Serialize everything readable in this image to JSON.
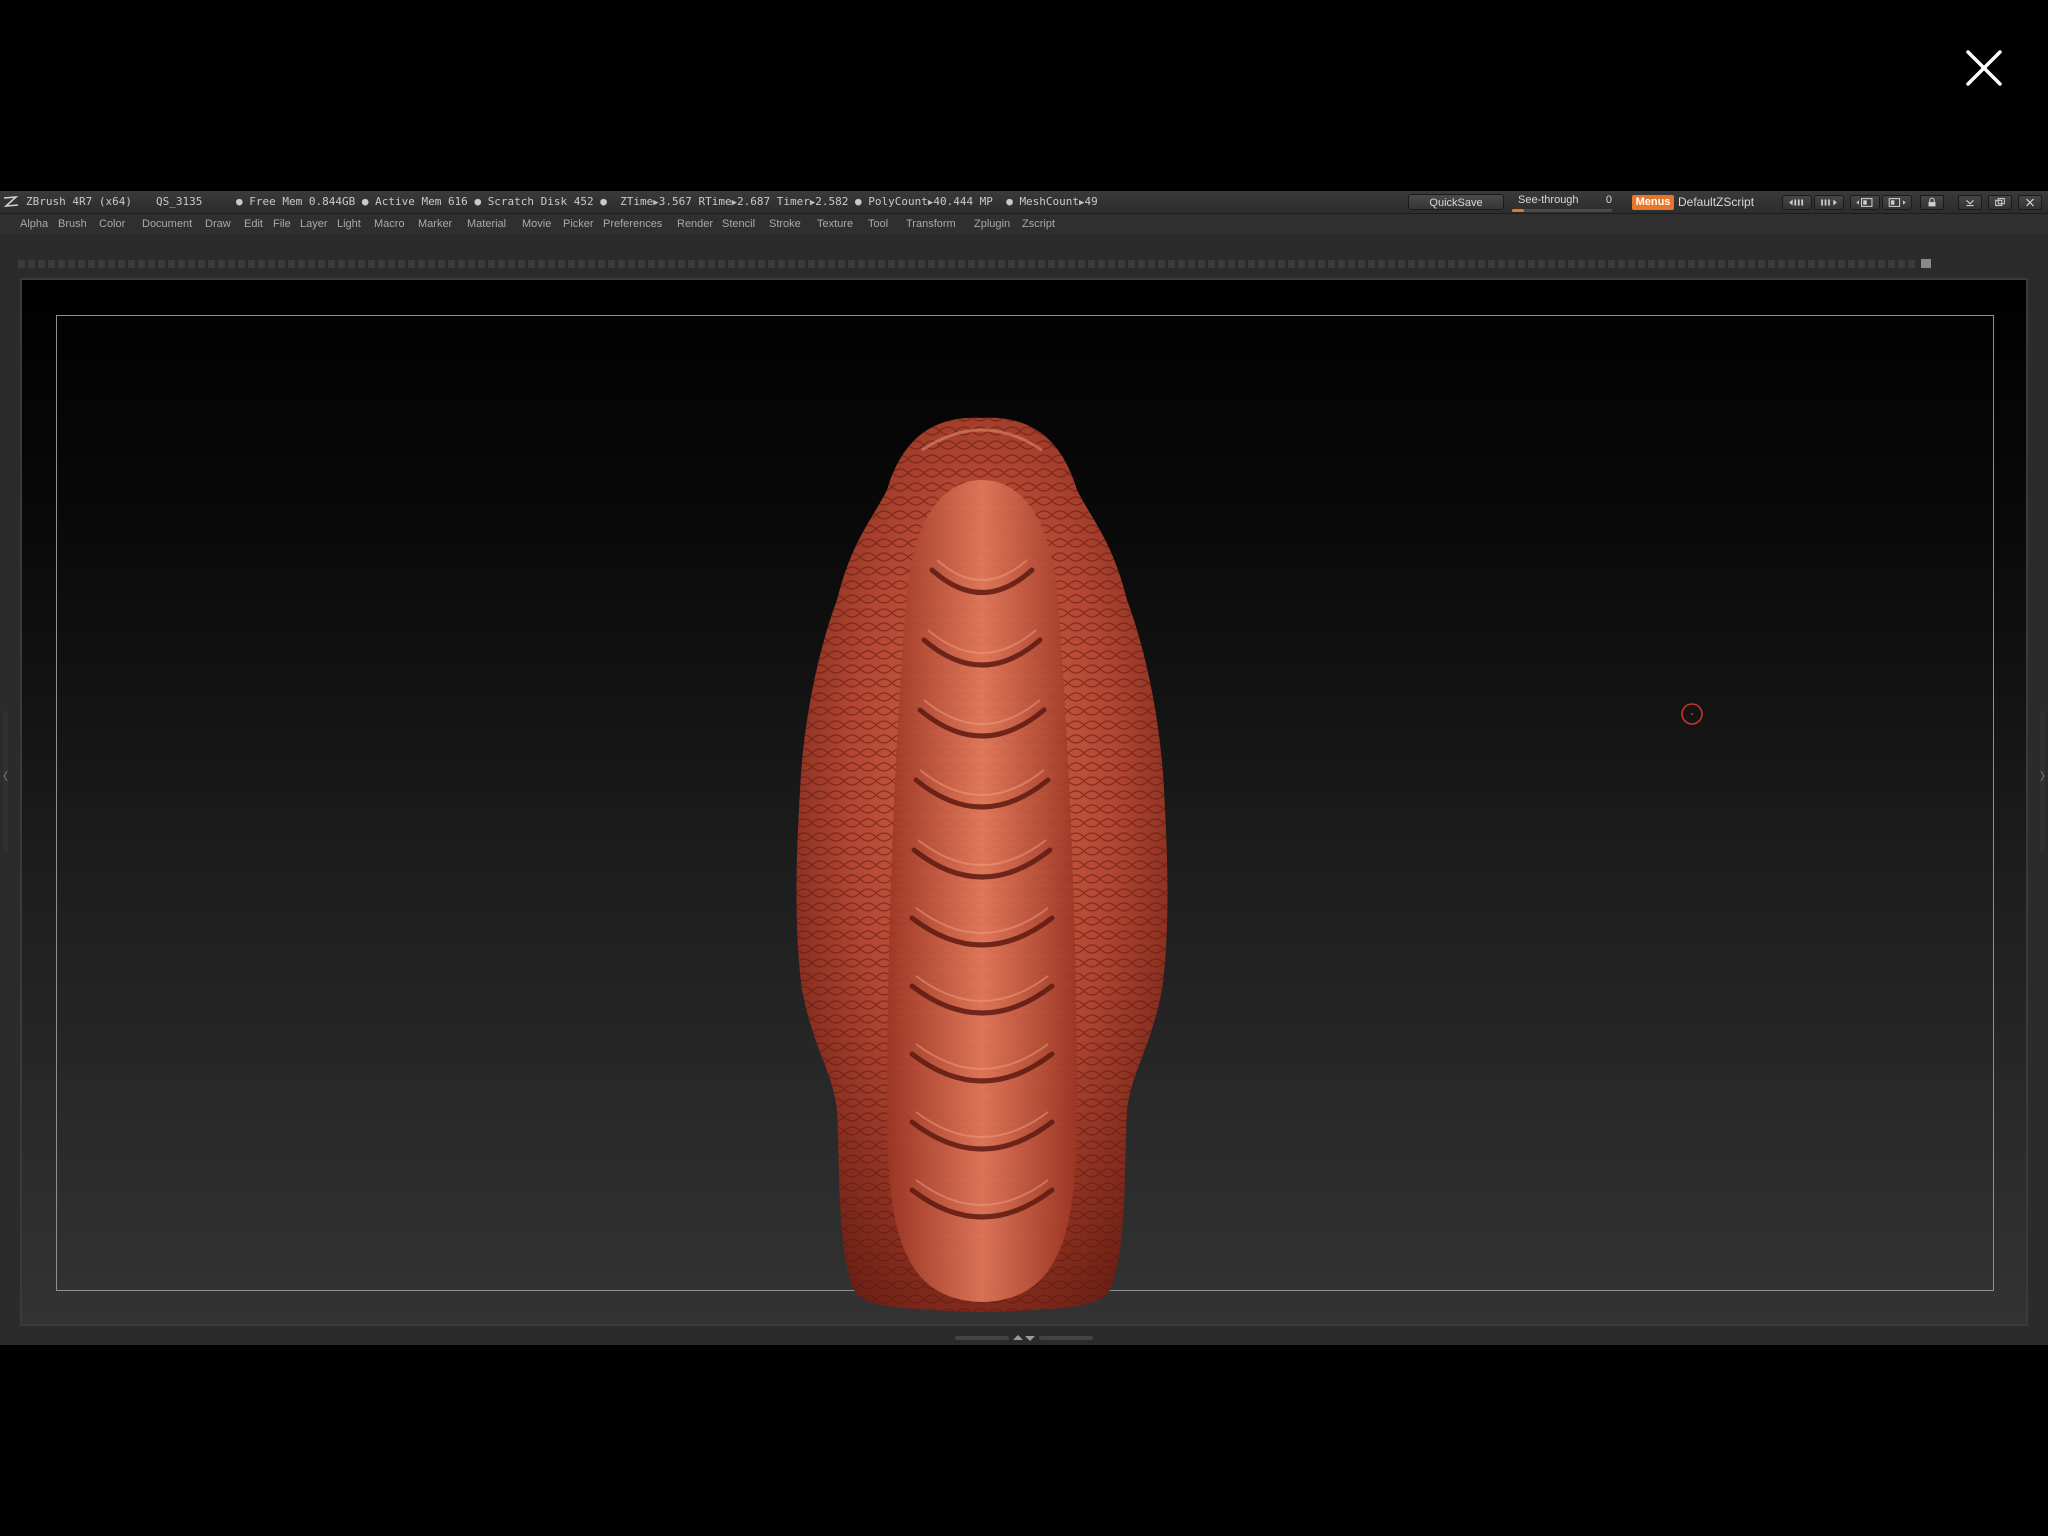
{
  "lightbox": {
    "close_icon": "close-icon"
  },
  "app": {
    "title": "ZBrush 4R7 (x64)",
    "document": "QS_3135",
    "stats": {
      "free_mem": "Free Mem 0.844GB",
      "active_mem": "Active Mem 616",
      "scratch_disk": "Scratch Disk 452",
      "ztime_label": "ZTime",
      "ztime_value": "3.567",
      "rtime_label": "RTime",
      "rtime_value": "2.687",
      "timer_label": "Timer",
      "timer_value": "2.582",
      "polycount_label": "PolyCount",
      "polycount_value": "40.444 MP",
      "meshcount_label": "MeshCount",
      "meshcount_value": "49"
    }
  },
  "toolbar": {
    "quicksave_label": "QuickSave",
    "seethrough_label": "See-through",
    "seethrough_value": "0",
    "seethrough_level": 0,
    "menus_label": "Menus",
    "script_label": "DefaultZScript"
  },
  "menubar": {
    "items": [
      "Alpha",
      "Brush",
      "Color",
      "Document",
      "Draw",
      "Edit",
      "File",
      "Layer",
      "Light",
      "Macro",
      "Marker",
      "Material",
      "Movie",
      "Picker",
      "Preferences",
      "Render",
      "Stencil",
      "Stroke",
      "Texture",
      "Tool",
      "Transform",
      "Zplugin",
      "Zscript"
    ]
  },
  "colors": {
    "accent": "#e8762a",
    "model_base": "#a0382a",
    "model_highlight": "#d86a50",
    "cursor": "#c0392b"
  }
}
